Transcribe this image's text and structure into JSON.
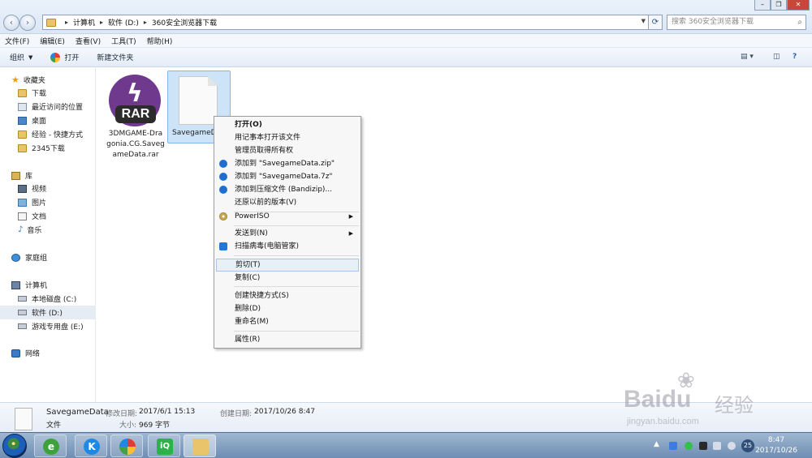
{
  "address": {
    "crumbs": [
      "计算机",
      "软件 (D:)",
      "360安全浏览器下载"
    ],
    "search_placeholder": "搜索 360安全浏览器下载"
  },
  "menu": [
    "文件(F)",
    "编辑(E)",
    "查看(V)",
    "工具(T)",
    "帮助(H)"
  ],
  "toolbar": {
    "organize": "组织",
    "open": "打开",
    "new_folder": "新建文件夹"
  },
  "nav": {
    "favorites": "收藏夹",
    "fav_items": [
      "下载",
      "最近访问的位置",
      "桌面",
      "经验 - 快捷方式",
      "2345下载"
    ],
    "libraries": "库",
    "lib_items": [
      "视频",
      "图片",
      "文档",
      "音乐"
    ],
    "homegroup": "家庭组",
    "computer": "计算机",
    "drives": [
      "本地磁盘 (C:)",
      "软件 (D:)",
      "游戏专用盘 (E:)"
    ],
    "network": "网络"
  },
  "files": [
    {
      "name": "3DMGAME-Dragonia.CG.SavegameData.rar",
      "name_lines": [
        "3DMGAME-Dra",
        "gonia.CG.Saveg",
        "ameData.rar"
      ],
      "icon_label": "RAR"
    },
    {
      "name": "SavegameData",
      "display": "SavegameD"
    }
  ],
  "context_menu": [
    {
      "label": "打开(O)",
      "bold": true
    },
    {
      "label": "用记事本打开该文件"
    },
    {
      "label": "管理员取得所有权"
    },
    {
      "label": "添加到 \"SavegameData.zip\"",
      "icon": "bandizip-icon"
    },
    {
      "label": "添加到 \"SavegameData.7z\"",
      "icon": "bandizip-icon"
    },
    {
      "label": "添加到压缩文件 (Bandizip)...",
      "icon": "bandizip-icon"
    },
    {
      "label": "还原以前的版本(V)"
    },
    {
      "label": "PowerISO",
      "icon": "poweriso-icon",
      "submenu": true
    },
    {
      "label": "发送到(N)",
      "submenu": true
    },
    {
      "label": "扫描病毒(电脑管家)",
      "icon": "shield-icon"
    },
    {
      "label": "剪切(T)",
      "hover": true
    },
    {
      "label": "复制(C)"
    },
    {
      "label": "创建快捷方式(S)"
    },
    {
      "label": "删除(D)"
    },
    {
      "label": "重命名(M)"
    },
    {
      "label": "属性(R)"
    }
  ],
  "details": {
    "name": "SavegameData",
    "type": "文件",
    "modified_label": "修改日期:",
    "modified": "2017/6/1 15:13",
    "created_label": "创建日期:",
    "created": "2017/10/26 8:47",
    "size_label": "大小:",
    "size": "969 字节"
  },
  "taskbar": {
    "apps": [
      "360-browser-icon",
      "kugou-icon",
      "paint-icon",
      "iqiyi-icon",
      "explorer-icon"
    ],
    "app_glyphs": [
      "e",
      "K",
      "",
      "iQ",
      ""
    ],
    "tray_badge": "25",
    "time": "8:47",
    "date": "2017/10/26"
  },
  "watermark": {
    "brand": "Bai",
    "brand2": "du",
    "cn": "经验",
    "url": "jingyan.baidu.com"
  },
  "colors": {
    "selection": "#cce3f8",
    "rar_purple": "#6f3a8e",
    "taskbar": "#7f9cc0"
  }
}
